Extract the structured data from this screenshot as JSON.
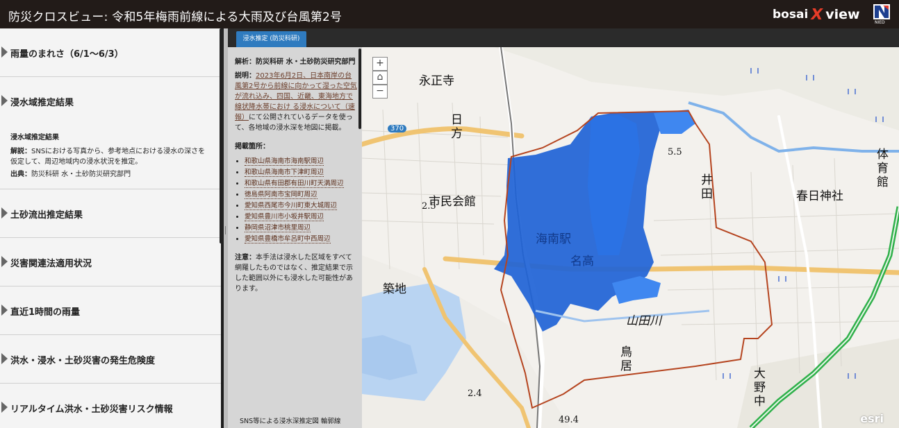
{
  "header": {
    "title": "防災クロスビュー: 令和5年梅雨前線による大雨及び台風第2号",
    "brand_left": "bosai",
    "brand_x": "X",
    "brand_right": "view",
    "org_mark": "NIED"
  },
  "sidebar": {
    "items": [
      {
        "label": "雨量のまれさ（6/1〜6/3）"
      },
      {
        "label": "浸水域推定結果"
      },
      {
        "label": "土砂流出推定結果"
      },
      {
        "label": "災害関連法適用状況"
      },
      {
        "label": "直近1時間の雨量"
      },
      {
        "label": "洪水・浸水・土砂災害の発生危険度"
      },
      {
        "label": "リアルタイム洪水・土砂災害リスク情報"
      }
    ],
    "detail": {
      "heading": "浸水域推定結果",
      "desc_label": "解説：",
      "desc": "SNSにおける写真から、参考地点における浸水の深さを仮定して、周辺地域内の浸水状況を推定。",
      "source_label": "出典：",
      "source": "防災科研 水・土砂防災研究部門"
    }
  },
  "tabs": {
    "active": "浸水推定 (防災科研)"
  },
  "info": {
    "analysis_label": "解析：",
    "analysis": "防災科研 水・土砂防災研究部門",
    "desc_label": "説明：",
    "desc_link": "2023年6月2日、日本南岸の台風第2号から前線に向かって湿った空気が流れ込み、四国、近畿、東海地方で線状降水帯におけ る浸水について（速報）",
    "desc_rest": "にて公開されているデータを使って、各地域の浸水深を地図に掲載。",
    "locations_label": "掲載箇所：",
    "locations": [
      "和歌山県海南市海南駅周辺",
      "和歌山県海南市下津町周辺",
      "和歌山県有田郡有田川町天満周辺",
      "徳島県阿南市宝岡町周辺",
      "愛知県西尾市今川町東大城周辺",
      "愛知県豊川市小坂井駅周辺",
      "静岡県沼津市桃里周辺",
      "愛知県豊橋市牟呂町中西周辺"
    ],
    "note_label": "注意：",
    "note": "本手法は浸水した区域をすべて網羅したものではなく、推定結果で示した範囲以外にも浸水した可能性があります。",
    "footer": "SNS等による浸水深推定図 輪郭線"
  },
  "map": {
    "zoom_in": "+",
    "home": "⌂",
    "zoom_out": "−",
    "labels": {
      "eishoji": "永正寺",
      "hi": "日",
      "kata": "方",
      "shiminkaikan": "市民会館",
      "kainan_eki": "海南駅",
      "nadaka": "名高",
      "chikuji": "築地",
      "yamadagawa": "山田川",
      "tori": "鳥",
      "i": "居",
      "tai": "体",
      "iku": "育",
      "kan": "館",
      "kasuga": "春日神社",
      "ii": "井",
      "den": "田",
      "oo": "大",
      "no": "野",
      "naka": "中",
      "route": "370",
      "elev1": "2.5",
      "elev2": "5.5",
      "elev3": "49.4",
      "elev4": "2.4"
    },
    "attribution": "esri",
    "colors": {
      "flood_deep": "#1f63d6",
      "flood_light": "#3f87f0",
      "boundary": "#b5441f",
      "highway": "#2fb04a"
    }
  }
}
